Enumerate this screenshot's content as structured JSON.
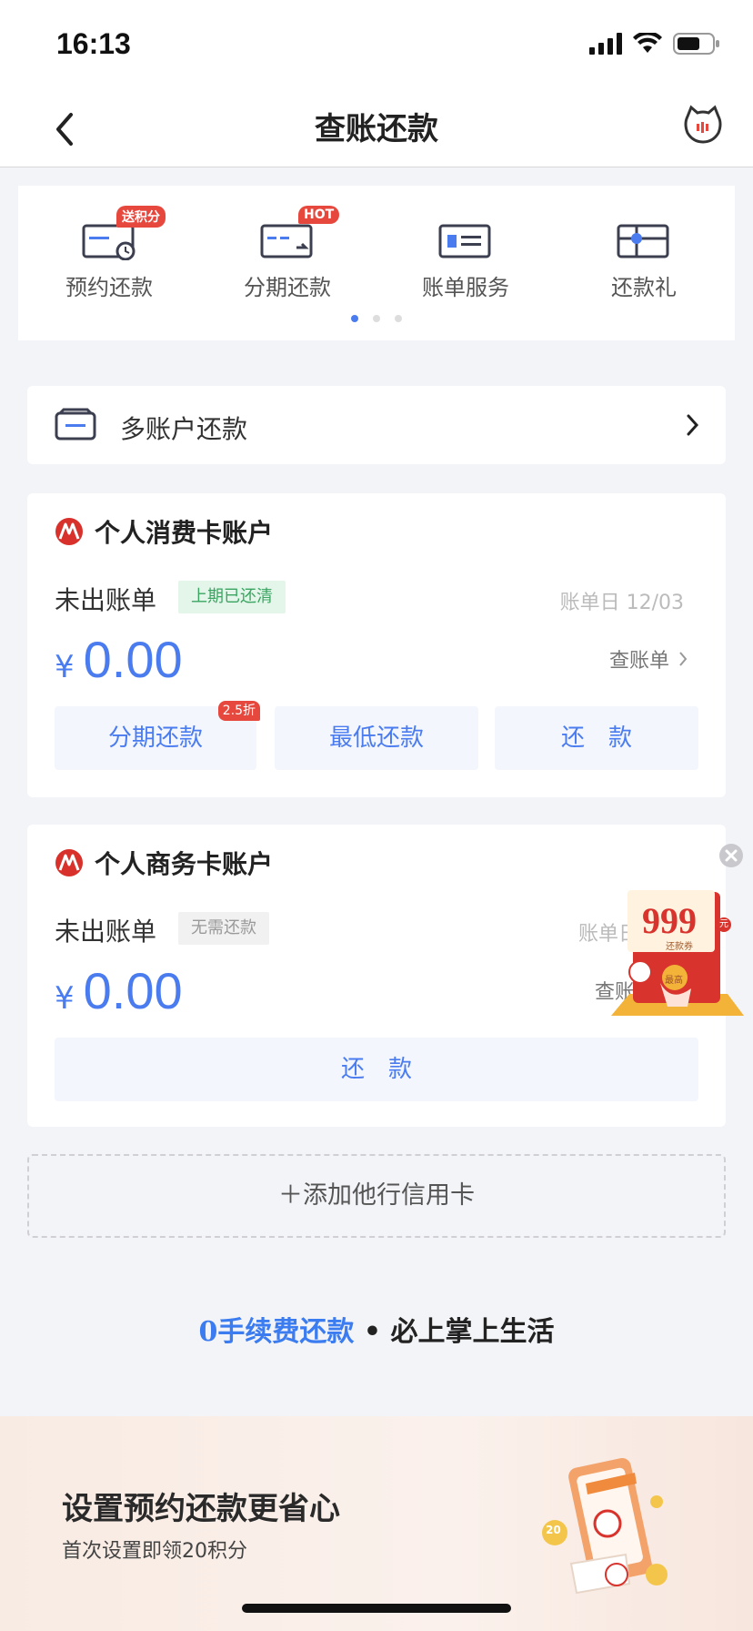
{
  "status_bar": {
    "time": "16:13"
  },
  "nav": {
    "title": "查账还款"
  },
  "quick_actions": [
    {
      "label": "预约还款",
      "badge": "送积分"
    },
    {
      "label": "分期还款",
      "badge": "HOT"
    },
    {
      "label": "账单服务",
      "badge": ""
    },
    {
      "label": "还款礼",
      "badge": ""
    }
  ],
  "multi_account": {
    "label": "多账户还款"
  },
  "accounts": [
    {
      "name": "个人消费卡账户",
      "bill_status": "未出账单",
      "tag": "上期已还清",
      "bill_date": "账单日 12/03",
      "currency": "¥",
      "amount": "0.00",
      "view_bill": "查账单",
      "buttons": {
        "installment": "分期还款",
        "installment_badge": "2.5折",
        "minimum": "最低还款",
        "repay": "还　款"
      }
    },
    {
      "name": "个人商务卡账户",
      "bill_status": "未出账单",
      "tag": "无需还款",
      "bill_date": "账单日",
      "currency": "¥",
      "amount": "0.00",
      "view_bill": "查账",
      "buttons": {
        "repay": "还　款"
      }
    }
  ],
  "float_ad": {
    "number": "999",
    "unit": "元",
    "caption": "还款券",
    "seal": "最高"
  },
  "add_card": {
    "label": "＋添加他行信用卡"
  },
  "slogan": {
    "highlight": "0手续费还款",
    "separator": " • ",
    "rest": "必上掌上生活"
  },
  "promo": {
    "title": "设置预约还款更省心",
    "subtitle": "首次设置即领20积分",
    "coin_text": "20"
  },
  "colors": {
    "accent": "#4a7cf0",
    "badge_red": "#e7483e",
    "success_green": "#3aa561"
  }
}
